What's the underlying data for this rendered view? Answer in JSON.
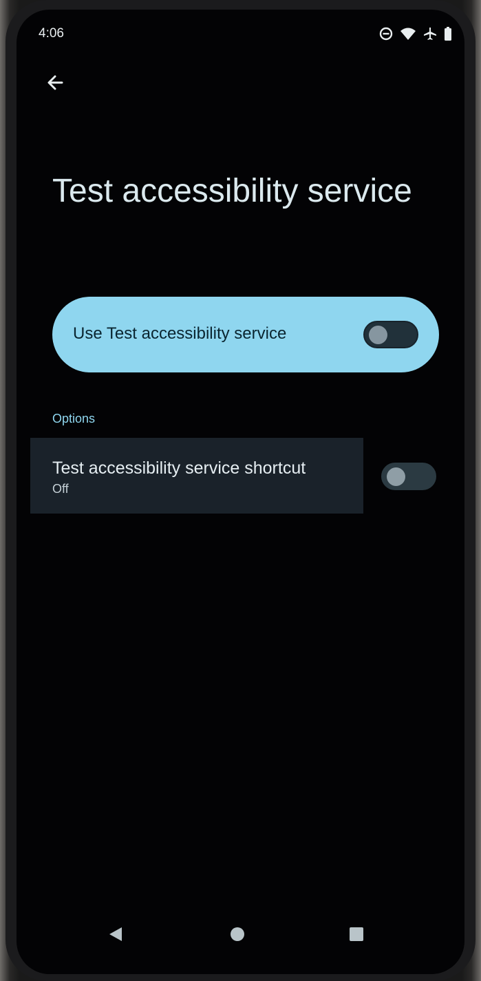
{
  "status_bar": {
    "time": "4:06",
    "icons": [
      "do-not-disturb-icon",
      "wifi-icon",
      "airplane-mode-icon",
      "battery-icon"
    ]
  },
  "header": {
    "back_icon": "arrow-back-icon",
    "title": "Test accessibility service"
  },
  "main_toggle": {
    "label": "Use Test accessibility service",
    "state": "off"
  },
  "options": {
    "section_label": "Options",
    "items": [
      {
        "title": "Test accessibility service shortcut",
        "summary": "Off",
        "state": "off"
      }
    ]
  },
  "nav_bar": {
    "buttons": [
      "nav-back-icon",
      "nav-home-icon",
      "nav-recents-icon"
    ]
  },
  "colors": {
    "accent": "#8fd6ef",
    "background": "#030305",
    "highlight_row": "#1a222a"
  }
}
